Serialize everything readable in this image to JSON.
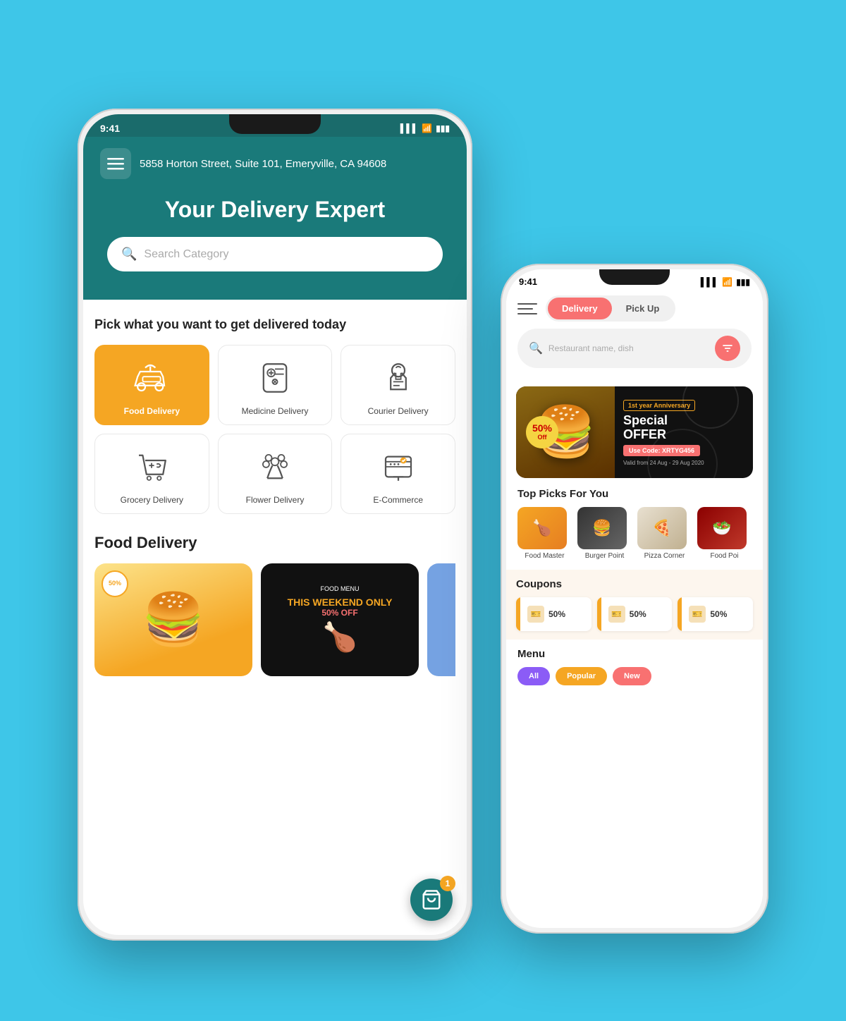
{
  "background": "#3ec6e8",
  "phone1": {
    "status_time": "9:41",
    "address": "5858 Horton Street, Suite 101,\nEmeryville, CA 94608",
    "hero_title": "Your Delivery Expert",
    "search_placeholder": "Search Category",
    "section_pick_title": "Pick what you want to get delivered today",
    "categories": [
      {
        "label": "Food Delivery",
        "active": true
      },
      {
        "label": "Medicine Delivery",
        "active": false
      },
      {
        "label": "Courier Delivery",
        "active": false
      },
      {
        "label": "Grocery Delivery",
        "active": false
      },
      {
        "label": "Flower Delivery",
        "active": false
      },
      {
        "label": "E-Commerce",
        "active": false
      }
    ],
    "food_section_title": "Food Delivery",
    "food_card1_badge": "50%",
    "cart_count": "1"
  },
  "phone2": {
    "status_time": "9:41",
    "toggle_delivery": "Delivery",
    "toggle_pickup": "Pick Up",
    "search_placeholder": "Restaurant name, dish",
    "banner": {
      "anniversary_label": "1st year Anniversary",
      "discount": "50% Off",
      "title": "Special\nOFFER",
      "code_label": "Use Code: XRTYG456",
      "valid_text": "Valid from\n24 Aug - 29 Aug 2020"
    },
    "top_picks_title": "Top Picks For You",
    "top_picks": [
      {
        "label": "Food Master"
      },
      {
        "label": "Burger Point"
      },
      {
        "label": "Pizza Corner"
      },
      {
        "label": "Food Poi"
      }
    ],
    "coupons_title": "Coupons",
    "coupons": [
      {
        "percent": "50%"
      },
      {
        "percent": "50%"
      },
      {
        "percent": "50%"
      }
    ],
    "menu_title": "Menu",
    "menu_tags": [
      "All",
      "Popular",
      "New"
    ]
  }
}
